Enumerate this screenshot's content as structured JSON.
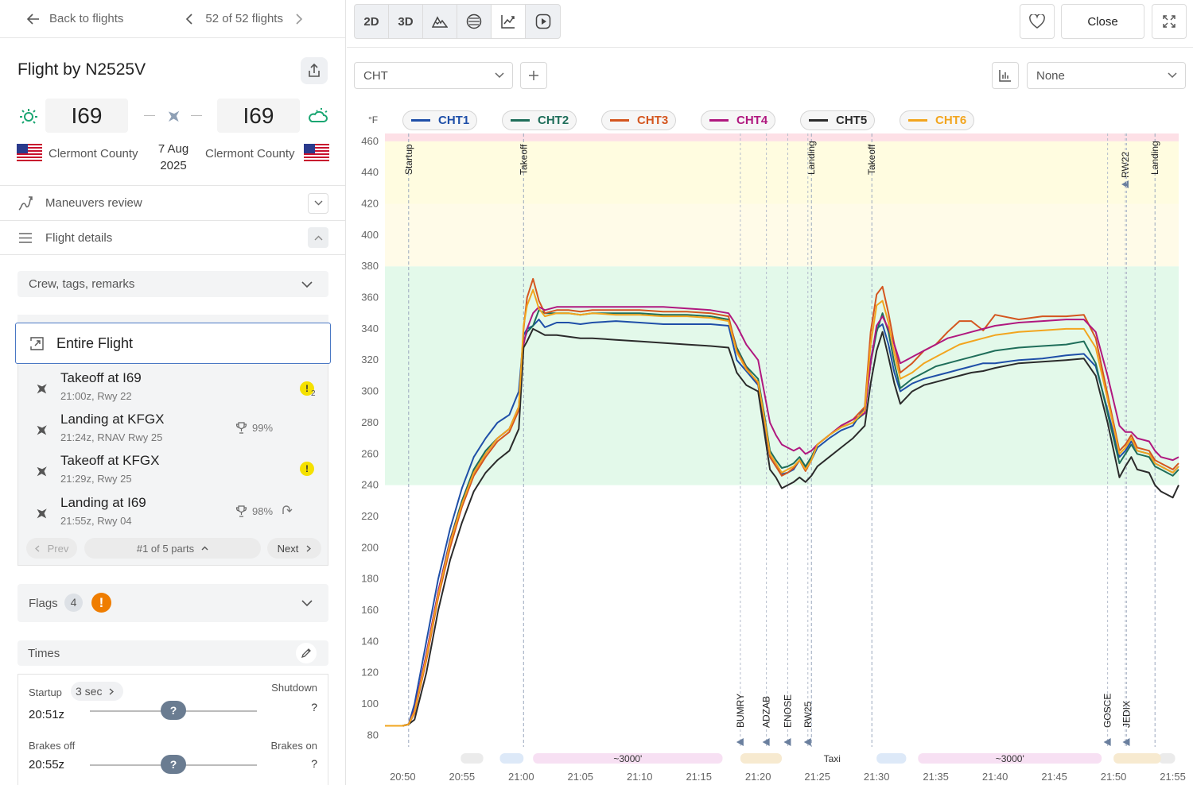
{
  "nav": {
    "back": "Back to flights",
    "pager": "52 of 52 flights"
  },
  "flight": {
    "title": "Flight by N2525V",
    "from_code": "I69",
    "to_code": "I69",
    "from_city": "Clermont County",
    "to_city": "Clermont County",
    "date_line1": "7 Aug",
    "date_line2": "2025"
  },
  "rows": {
    "maneuvers": "Maneuvers review",
    "details": "Flight details"
  },
  "crew": "Crew, tags, remarks",
  "entire": "Entire Flight",
  "parts": [
    {
      "title": "Takeoff at I69",
      "sub": "21:00z, Rwy 22",
      "badge": "!",
      "badge_count": "2"
    },
    {
      "title": "Landing at KFGX",
      "sub": "21:24z, RNAV Rwy 25",
      "score": "99%"
    },
    {
      "title": "Takeoff at KFGX",
      "sub": "21:29z, Rwy 25",
      "badge": "!"
    },
    {
      "title": "Landing at I69",
      "sub": "21:55z, Rwy 04",
      "score": "98%"
    }
  ],
  "parts_nav": {
    "prev": "Prev",
    "count": "#1 of 5 parts",
    "next": "Next"
  },
  "flags": {
    "label": "Flags",
    "count": "4",
    "alert": "!"
  },
  "times": {
    "label": "Times",
    "startup_label": "Startup",
    "startup_dur": "3 sec",
    "startup_time": "20:51z",
    "shutdown_label": "Shutdown",
    "shutdown_val": "?",
    "brakes_off_label": "Brakes off",
    "brakes_off_time": "20:55z",
    "brakes_on_label": "Brakes on",
    "brakes_on_val": "?",
    "knob": "?"
  },
  "toolbar": {
    "b2d": "2D",
    "b3d": "3D",
    "close": "Close"
  },
  "selectors": {
    "param": "CHT",
    "compare": "None"
  },
  "colors": {
    "accent": "#4a78c4",
    "alert": "#ef7d00",
    "warn": "#f5e100"
  },
  "chart_data": {
    "type": "line",
    "ylabel": "°F",
    "ylim": [
      70,
      465
    ],
    "yticks": [
      80,
      100,
      120,
      140,
      160,
      180,
      200,
      220,
      240,
      260,
      280,
      300,
      320,
      340,
      360,
      380,
      400,
      420,
      440,
      460
    ],
    "xticks": [
      "20:50",
      "20:55",
      "21:00",
      "21:05",
      "21:10",
      "21:15",
      "21:20",
      "21:25",
      "21:30",
      "21:35",
      "21:40",
      "21:45",
      "21:50",
      "21:55"
    ],
    "xlim_min": [
      -1.5,
      65.5
    ],
    "bands": [
      {
        "from": 240,
        "to": 380,
        "color": "#e3f9ea"
      },
      {
        "from": 380,
        "to": 420,
        "color": "#fffbe8"
      },
      {
        "from": 420,
        "to": 460,
        "color": "#fffce0"
      },
      {
        "from": 460,
        "to": 465,
        "color": "#fde0e6"
      }
    ],
    "events_top": [
      {
        "t": 0.5,
        "label": "Startup"
      },
      {
        "t": 10.2,
        "label": "Takeoff"
      },
      {
        "t": 34.5,
        "label": "Landing"
      },
      {
        "t": 39.6,
        "label": "Takeoff"
      },
      {
        "t": 63.5,
        "label": "Landing"
      }
    ],
    "waypoints": [
      {
        "t": 28.5,
        "label": "BUMRY"
      },
      {
        "t": 30.7,
        "label": "ADZAB"
      },
      {
        "t": 32.5,
        "label": "ENOSE"
      },
      {
        "t": 34.2,
        "label": "RW25"
      },
      {
        "t": 61.0,
        "label": "RW22",
        "top": true
      },
      {
        "t": 59.5,
        "label": "GOSCE"
      },
      {
        "t": 61.1,
        "label": "JEDIX"
      }
    ],
    "phases": [
      {
        "from": 8.2,
        "to": 10.2,
        "color": "#dde9f8",
        "label": ""
      },
      {
        "from": 11.0,
        "to": 27.0,
        "color": "#f7e0f3",
        "label": "~3000'"
      },
      {
        "from": 28.5,
        "to": 32.0,
        "color": "#f7ead0",
        "label": ""
      },
      {
        "from": 34.0,
        "to": 38.5,
        "color": "#ffffff",
        "label": "Taxi"
      },
      {
        "from": 40.0,
        "to": 42.5,
        "color": "#dde9f8",
        "label": ""
      },
      {
        "from": 43.5,
        "to": 59.0,
        "color": "#f7e0f3",
        "label": "~3000'"
      },
      {
        "from": 60.0,
        "to": 64.0,
        "color": "#f7ead0",
        "label": ""
      }
    ],
    "keyframes_t": [
      -1.5,
      0,
      0.5,
      1,
      2,
      3,
      4,
      5,
      6,
      7,
      8,
      9,
      9.8,
      10.2,
      10.5,
      11,
      11.5,
      12,
      13,
      14,
      15,
      16,
      18,
      20,
      22,
      24,
      26,
      27.5,
      28.2,
      29,
      30,
      30.5,
      31,
      31.5,
      32,
      32.5,
      33,
      33.5,
      34,
      34.5,
      35,
      36,
      37,
      38,
      39,
      39.5,
      40,
      40.5,
      41,
      41.5,
      42,
      43,
      44,
      45,
      46,
      47,
      48,
      49,
      50,
      52,
      54,
      56,
      57.5,
      58.5,
      59.5,
      60.5,
      61,
      61.5,
      62,
      63,
      63.5,
      64,
      65,
      65.5
    ],
    "series": [
      {
        "name": "CHT1",
        "color": "#1f4fa8",
        "values": [
          86,
          86,
          87,
          100,
          140,
          180,
          212,
          238,
          258,
          270,
          280,
          285,
          300,
          336,
          340,
          342,
          346,
          341,
          344,
          344,
          343,
          344,
          345,
          344,
          343,
          343,
          343,
          342,
          320,
          313,
          304,
          280,
          258,
          252,
          247,
          248,
          250,
          256,
          251,
          256,
          264,
          270,
          275,
          278,
          290,
          320,
          340,
          343,
          330,
          312,
          300,
          305,
          308,
          310,
          312,
          314,
          316,
          318,
          318,
          320,
          321,
          323,
          324,
          316,
          288,
          258,
          262,
          268,
          262,
          260,
          254,
          252,
          248,
          252,
          262,
          266
        ]
      },
      {
        "name": "CHT2",
        "color": "#1f6e5a",
        "values": [
          86,
          86,
          87,
          96,
          132,
          172,
          205,
          230,
          250,
          262,
          270,
          276,
          290,
          332,
          338,
          342,
          352,
          350,
          350,
          350,
          349,
          350,
          350,
          350,
          349,
          349,
          348,
          346,
          328,
          316,
          308,
          286,
          262,
          256,
          251,
          252,
          254,
          258,
          252,
          258,
          266,
          272,
          277,
          280,
          286,
          318,
          338,
          350,
          338,
          318,
          302,
          308,
          312,
          316,
          318,
          320,
          322,
          324,
          326,
          328,
          329,
          330,
          332,
          318,
          286,
          254,
          260,
          266,
          260,
          258,
          252,
          250,
          246,
          250,
          262,
          266
        ]
      },
      {
        "name": "CHT3",
        "color": "#d4561f",
        "values": [
          86,
          86,
          87,
          94,
          128,
          168,
          200,
          226,
          246,
          258,
          268,
          274,
          288,
          340,
          360,
          372,
          358,
          350,
          352,
          352,
          351,
          352,
          352,
          352,
          351,
          351,
          350,
          348,
          326,
          315,
          305,
          283,
          258,
          252,
          246,
          248,
          251,
          256,
          249,
          256,
          266,
          272,
          278,
          282,
          290,
          338,
          362,
          367,
          350,
          330,
          312,
          318,
          326,
          330,
          338,
          345,
          345,
          339,
          349,
          346,
          348,
          348,
          349,
          334,
          298,
          262,
          266,
          272,
          264,
          262,
          256,
          254,
          250,
          254,
          266,
          270
        ]
      },
      {
        "name": "CHT4",
        "color": "#b0187f",
        "values": [
          86,
          86,
          87,
          96,
          132,
          172,
          204,
          228,
          248,
          260,
          270,
          276,
          290,
          330,
          340,
          350,
          354,
          352,
          354,
          354,
          354,
          354,
          354,
          354,
          354,
          353,
          352,
          350,
          342,
          330,
          320,
          300,
          280,
          272,
          266,
          264,
          262,
          264,
          260,
          262,
          266,
          272,
          278,
          282,
          286,
          318,
          342,
          348,
          340,
          330,
          318,
          322,
          326,
          330,
          334,
          336,
          338,
          340,
          342,
          344,
          345,
          346,
          346,
          338,
          310,
          278,
          274,
          274,
          270,
          268,
          262,
          258,
          256,
          258,
          266,
          270
        ]
      },
      {
        "name": "CHT5",
        "color": "#2b2b2b",
        "values": [
          86,
          86,
          87,
          90,
          120,
          160,
          192,
          216,
          236,
          248,
          256,
          262,
          276,
          328,
          332,
          340,
          338,
          336,
          336,
          335,
          334,
          334,
          333,
          332,
          331,
          330,
          329,
          328,
          312,
          304,
          300,
          275,
          250,
          245,
          238,
          240,
          242,
          245,
          242,
          246,
          252,
          258,
          264,
          270,
          278,
          305,
          326,
          338,
          322,
          305,
          292,
          300,
          304,
          306,
          308,
          310,
          312,
          313,
          315,
          318,
          319,
          320,
          321,
          310,
          280,
          245,
          252,
          258,
          250,
          248,
          240,
          236,
          232,
          240,
          254,
          262
        ]
      },
      {
        "name": "CHT6",
        "color": "#f2a51e",
        "values": [
          86,
          86,
          87,
          95,
          130,
          170,
          203,
          228,
          248,
          260,
          270,
          276,
          290,
          342,
          355,
          365,
          353,
          348,
          350,
          350,
          349,
          350,
          349,
          349,
          348,
          348,
          347,
          345,
          325,
          314,
          306,
          284,
          260,
          254,
          248,
          250,
          252,
          256,
          250,
          256,
          266,
          272,
          277,
          280,
          288,
          330,
          355,
          358,
          344,
          324,
          308,
          312,
          318,
          322,
          326,
          330,
          332,
          334,
          336,
          338,
          339,
          340,
          340,
          328,
          295,
          260,
          264,
          270,
          262,
          260,
          254,
          252,
          248,
          252,
          264,
          268
        ]
      }
    ]
  }
}
